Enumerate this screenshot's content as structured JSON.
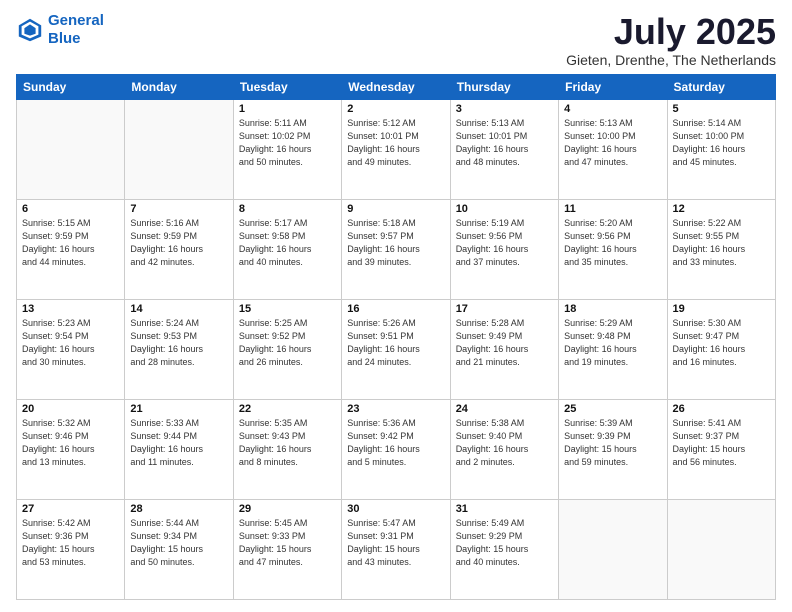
{
  "logo": {
    "line1": "General",
    "line2": "Blue"
  },
  "header": {
    "month": "July 2025",
    "location": "Gieten, Drenthe, The Netherlands"
  },
  "days_of_week": [
    "Sunday",
    "Monday",
    "Tuesday",
    "Wednesday",
    "Thursday",
    "Friday",
    "Saturday"
  ],
  "weeks": [
    [
      {
        "day": "",
        "empty": true
      },
      {
        "day": "",
        "empty": true
      },
      {
        "day": "1",
        "sunrise": "5:11 AM",
        "sunset": "10:02 PM",
        "daylight": "16 hours and 50 minutes."
      },
      {
        "day": "2",
        "sunrise": "5:12 AM",
        "sunset": "10:01 PM",
        "daylight": "16 hours and 49 minutes."
      },
      {
        "day": "3",
        "sunrise": "5:13 AM",
        "sunset": "10:01 PM",
        "daylight": "16 hours and 48 minutes."
      },
      {
        "day": "4",
        "sunrise": "5:13 AM",
        "sunset": "10:00 PM",
        "daylight": "16 hours and 47 minutes."
      },
      {
        "day": "5",
        "sunrise": "5:14 AM",
        "sunset": "10:00 PM",
        "daylight": "16 hours and 45 minutes."
      }
    ],
    [
      {
        "day": "6",
        "sunrise": "5:15 AM",
        "sunset": "9:59 PM",
        "daylight": "16 hours and 44 minutes."
      },
      {
        "day": "7",
        "sunrise": "5:16 AM",
        "sunset": "9:59 PM",
        "daylight": "16 hours and 42 minutes."
      },
      {
        "day": "8",
        "sunrise": "5:17 AM",
        "sunset": "9:58 PM",
        "daylight": "16 hours and 40 minutes."
      },
      {
        "day": "9",
        "sunrise": "5:18 AM",
        "sunset": "9:57 PM",
        "daylight": "16 hours and 39 minutes."
      },
      {
        "day": "10",
        "sunrise": "5:19 AM",
        "sunset": "9:56 PM",
        "daylight": "16 hours and 37 minutes."
      },
      {
        "day": "11",
        "sunrise": "5:20 AM",
        "sunset": "9:56 PM",
        "daylight": "16 hours and 35 minutes."
      },
      {
        "day": "12",
        "sunrise": "5:22 AM",
        "sunset": "9:55 PM",
        "daylight": "16 hours and 33 minutes."
      }
    ],
    [
      {
        "day": "13",
        "sunrise": "5:23 AM",
        "sunset": "9:54 PM",
        "daylight": "16 hours and 30 minutes."
      },
      {
        "day": "14",
        "sunrise": "5:24 AM",
        "sunset": "9:53 PM",
        "daylight": "16 hours and 28 minutes."
      },
      {
        "day": "15",
        "sunrise": "5:25 AM",
        "sunset": "9:52 PM",
        "daylight": "16 hours and 26 minutes."
      },
      {
        "day": "16",
        "sunrise": "5:26 AM",
        "sunset": "9:51 PM",
        "daylight": "16 hours and 24 minutes."
      },
      {
        "day": "17",
        "sunrise": "5:28 AM",
        "sunset": "9:49 PM",
        "daylight": "16 hours and 21 minutes."
      },
      {
        "day": "18",
        "sunrise": "5:29 AM",
        "sunset": "9:48 PM",
        "daylight": "16 hours and 19 minutes."
      },
      {
        "day": "19",
        "sunrise": "5:30 AM",
        "sunset": "9:47 PM",
        "daylight": "16 hours and 16 minutes."
      }
    ],
    [
      {
        "day": "20",
        "sunrise": "5:32 AM",
        "sunset": "9:46 PM",
        "daylight": "16 hours and 13 minutes."
      },
      {
        "day": "21",
        "sunrise": "5:33 AM",
        "sunset": "9:44 PM",
        "daylight": "16 hours and 11 minutes."
      },
      {
        "day": "22",
        "sunrise": "5:35 AM",
        "sunset": "9:43 PM",
        "daylight": "16 hours and 8 minutes."
      },
      {
        "day": "23",
        "sunrise": "5:36 AM",
        "sunset": "9:42 PM",
        "daylight": "16 hours and 5 minutes."
      },
      {
        "day": "24",
        "sunrise": "5:38 AM",
        "sunset": "9:40 PM",
        "daylight": "16 hours and 2 minutes."
      },
      {
        "day": "25",
        "sunrise": "5:39 AM",
        "sunset": "9:39 PM",
        "daylight": "15 hours and 59 minutes."
      },
      {
        "day": "26",
        "sunrise": "5:41 AM",
        "sunset": "9:37 PM",
        "daylight": "15 hours and 56 minutes."
      }
    ],
    [
      {
        "day": "27",
        "sunrise": "5:42 AM",
        "sunset": "9:36 PM",
        "daylight": "15 hours and 53 minutes."
      },
      {
        "day": "28",
        "sunrise": "5:44 AM",
        "sunset": "9:34 PM",
        "daylight": "15 hours and 50 minutes."
      },
      {
        "day": "29",
        "sunrise": "5:45 AM",
        "sunset": "9:33 PM",
        "daylight": "15 hours and 47 minutes."
      },
      {
        "day": "30",
        "sunrise": "5:47 AM",
        "sunset": "9:31 PM",
        "daylight": "15 hours and 43 minutes."
      },
      {
        "day": "31",
        "sunrise": "5:49 AM",
        "sunset": "9:29 PM",
        "daylight": "15 hours and 40 minutes."
      },
      {
        "day": "",
        "empty": true
      },
      {
        "day": "",
        "empty": true
      }
    ]
  ]
}
